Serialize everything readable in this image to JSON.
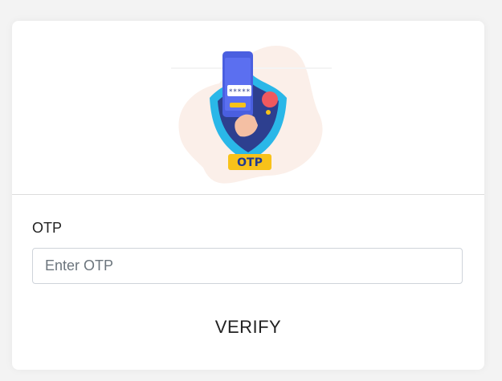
{
  "form": {
    "otp_label": "OTP",
    "otp_placeholder": "Enter OTP",
    "otp_value": "",
    "verify_label": "VERIFY"
  },
  "illustration": {
    "badge_text": "OTP",
    "screen_mask": "*****",
    "icon": "otp-shield-phone-illustration"
  },
  "colors": {
    "page_background": "#f3f3f3",
    "card_background": "#ffffff",
    "shield_blue": "#2ab7e8",
    "phone_purple": "#4a5fe0",
    "badge_yellow": "#f8c21a",
    "accent_red": "#f0595e"
  }
}
